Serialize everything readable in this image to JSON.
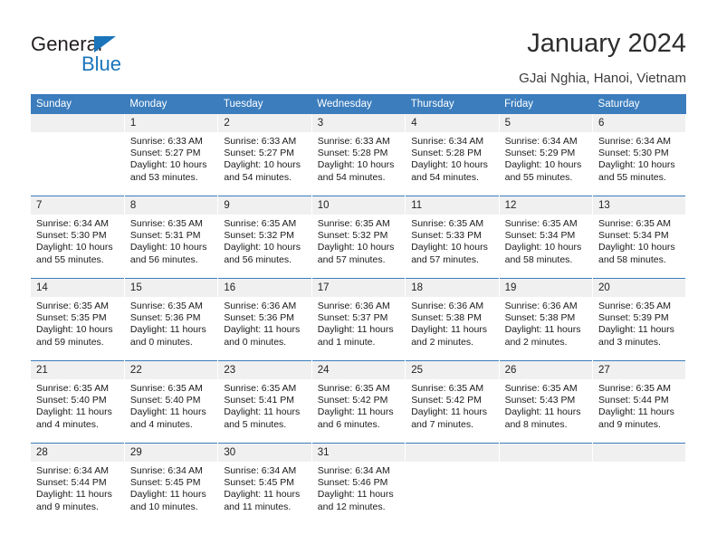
{
  "brand": {
    "name_top": "General",
    "name_bottom": "Blue",
    "triangle_color": "#1b75bb"
  },
  "header": {
    "title": "January 2024",
    "subtitle": "GJai Nghia, Hanoi, Vietnam",
    "header_bg": "#3b7dbd",
    "daynum_bg": "#f0f0f0"
  },
  "calendar": {
    "weekday_headers": [
      "Sunday",
      "Monday",
      "Tuesday",
      "Wednesday",
      "Thursday",
      "Friday",
      "Saturday"
    ],
    "labels": {
      "sunrise": "Sunrise:",
      "sunset": "Sunset:",
      "daylight": "Daylight:"
    },
    "weeks": [
      [
        {
          "day": "",
          "empty": true,
          "sunrise": "",
          "sunset": "",
          "daylight_1": "",
          "daylight_2": ""
        },
        {
          "day": "1",
          "empty": false,
          "sunrise": "Sunrise: 6:33 AM",
          "sunset": "Sunset: 5:27 PM",
          "daylight_1": "Daylight: 10 hours",
          "daylight_2": "and 53 minutes."
        },
        {
          "day": "2",
          "empty": false,
          "sunrise": "Sunrise: 6:33 AM",
          "sunset": "Sunset: 5:27 PM",
          "daylight_1": "Daylight: 10 hours",
          "daylight_2": "and 54 minutes."
        },
        {
          "day": "3",
          "empty": false,
          "sunrise": "Sunrise: 6:33 AM",
          "sunset": "Sunset: 5:28 PM",
          "daylight_1": "Daylight: 10 hours",
          "daylight_2": "and 54 minutes."
        },
        {
          "day": "4",
          "empty": false,
          "sunrise": "Sunrise: 6:34 AM",
          "sunset": "Sunset: 5:28 PM",
          "daylight_1": "Daylight: 10 hours",
          "daylight_2": "and 54 minutes."
        },
        {
          "day": "5",
          "empty": false,
          "sunrise": "Sunrise: 6:34 AM",
          "sunset": "Sunset: 5:29 PM",
          "daylight_1": "Daylight: 10 hours",
          "daylight_2": "and 55 minutes."
        },
        {
          "day": "6",
          "empty": false,
          "sunrise": "Sunrise: 6:34 AM",
          "sunset": "Sunset: 5:30 PM",
          "daylight_1": "Daylight: 10 hours",
          "daylight_2": "and 55 minutes."
        }
      ],
      [
        {
          "day": "7",
          "empty": false,
          "sunrise": "Sunrise: 6:34 AM",
          "sunset": "Sunset: 5:30 PM",
          "daylight_1": "Daylight: 10 hours",
          "daylight_2": "and 55 minutes."
        },
        {
          "day": "8",
          "empty": false,
          "sunrise": "Sunrise: 6:35 AM",
          "sunset": "Sunset: 5:31 PM",
          "daylight_1": "Daylight: 10 hours",
          "daylight_2": "and 56 minutes."
        },
        {
          "day": "9",
          "empty": false,
          "sunrise": "Sunrise: 6:35 AM",
          "sunset": "Sunset: 5:32 PM",
          "daylight_1": "Daylight: 10 hours",
          "daylight_2": "and 56 minutes."
        },
        {
          "day": "10",
          "empty": false,
          "sunrise": "Sunrise: 6:35 AM",
          "sunset": "Sunset: 5:32 PM",
          "daylight_1": "Daylight: 10 hours",
          "daylight_2": "and 57 minutes."
        },
        {
          "day": "11",
          "empty": false,
          "sunrise": "Sunrise: 6:35 AM",
          "sunset": "Sunset: 5:33 PM",
          "daylight_1": "Daylight: 10 hours",
          "daylight_2": "and 57 minutes."
        },
        {
          "day": "12",
          "empty": false,
          "sunrise": "Sunrise: 6:35 AM",
          "sunset": "Sunset: 5:34 PM",
          "daylight_1": "Daylight: 10 hours",
          "daylight_2": "and 58 minutes."
        },
        {
          "day": "13",
          "empty": false,
          "sunrise": "Sunrise: 6:35 AM",
          "sunset": "Sunset: 5:34 PM",
          "daylight_1": "Daylight: 10 hours",
          "daylight_2": "and 58 minutes."
        }
      ],
      [
        {
          "day": "14",
          "empty": false,
          "sunrise": "Sunrise: 6:35 AM",
          "sunset": "Sunset: 5:35 PM",
          "daylight_1": "Daylight: 10 hours",
          "daylight_2": "and 59 minutes."
        },
        {
          "day": "15",
          "empty": false,
          "sunrise": "Sunrise: 6:35 AM",
          "sunset": "Sunset: 5:36 PM",
          "daylight_1": "Daylight: 11 hours",
          "daylight_2": "and 0 minutes."
        },
        {
          "day": "16",
          "empty": false,
          "sunrise": "Sunrise: 6:36 AM",
          "sunset": "Sunset: 5:36 PM",
          "daylight_1": "Daylight: 11 hours",
          "daylight_2": "and 0 minutes."
        },
        {
          "day": "17",
          "empty": false,
          "sunrise": "Sunrise: 6:36 AM",
          "sunset": "Sunset: 5:37 PM",
          "daylight_1": "Daylight: 11 hours",
          "daylight_2": "and 1 minute."
        },
        {
          "day": "18",
          "empty": false,
          "sunrise": "Sunrise: 6:36 AM",
          "sunset": "Sunset: 5:38 PM",
          "daylight_1": "Daylight: 11 hours",
          "daylight_2": "and 2 minutes."
        },
        {
          "day": "19",
          "empty": false,
          "sunrise": "Sunrise: 6:36 AM",
          "sunset": "Sunset: 5:38 PM",
          "daylight_1": "Daylight: 11 hours",
          "daylight_2": "and 2 minutes."
        },
        {
          "day": "20",
          "empty": false,
          "sunrise": "Sunrise: 6:35 AM",
          "sunset": "Sunset: 5:39 PM",
          "daylight_1": "Daylight: 11 hours",
          "daylight_2": "and 3 minutes."
        }
      ],
      [
        {
          "day": "21",
          "empty": false,
          "sunrise": "Sunrise: 6:35 AM",
          "sunset": "Sunset: 5:40 PM",
          "daylight_1": "Daylight: 11 hours",
          "daylight_2": "and 4 minutes."
        },
        {
          "day": "22",
          "empty": false,
          "sunrise": "Sunrise: 6:35 AM",
          "sunset": "Sunset: 5:40 PM",
          "daylight_1": "Daylight: 11 hours",
          "daylight_2": "and 4 minutes."
        },
        {
          "day": "23",
          "empty": false,
          "sunrise": "Sunrise: 6:35 AM",
          "sunset": "Sunset: 5:41 PM",
          "daylight_1": "Daylight: 11 hours",
          "daylight_2": "and 5 minutes."
        },
        {
          "day": "24",
          "empty": false,
          "sunrise": "Sunrise: 6:35 AM",
          "sunset": "Sunset: 5:42 PM",
          "daylight_1": "Daylight: 11 hours",
          "daylight_2": "and 6 minutes."
        },
        {
          "day": "25",
          "empty": false,
          "sunrise": "Sunrise: 6:35 AM",
          "sunset": "Sunset: 5:42 PM",
          "daylight_1": "Daylight: 11 hours",
          "daylight_2": "and 7 minutes."
        },
        {
          "day": "26",
          "empty": false,
          "sunrise": "Sunrise: 6:35 AM",
          "sunset": "Sunset: 5:43 PM",
          "daylight_1": "Daylight: 11 hours",
          "daylight_2": "and 8 minutes."
        },
        {
          "day": "27",
          "empty": false,
          "sunrise": "Sunrise: 6:35 AM",
          "sunset": "Sunset: 5:44 PM",
          "daylight_1": "Daylight: 11 hours",
          "daylight_2": "and 9 minutes."
        }
      ],
      [
        {
          "day": "28",
          "empty": false,
          "sunrise": "Sunrise: 6:34 AM",
          "sunset": "Sunset: 5:44 PM",
          "daylight_1": "Daylight: 11 hours",
          "daylight_2": "and 9 minutes."
        },
        {
          "day": "29",
          "empty": false,
          "sunrise": "Sunrise: 6:34 AM",
          "sunset": "Sunset: 5:45 PM",
          "daylight_1": "Daylight: 11 hours",
          "daylight_2": "and 10 minutes."
        },
        {
          "day": "30",
          "empty": false,
          "sunrise": "Sunrise: 6:34 AM",
          "sunset": "Sunset: 5:45 PM",
          "daylight_1": "Daylight: 11 hours",
          "daylight_2": "and 11 minutes."
        },
        {
          "day": "31",
          "empty": false,
          "sunrise": "Sunrise: 6:34 AM",
          "sunset": "Sunset: 5:46 PM",
          "daylight_1": "Daylight: 11 hours",
          "daylight_2": "and 12 minutes."
        },
        {
          "day": "",
          "empty": true,
          "sunrise": "",
          "sunset": "",
          "daylight_1": "",
          "daylight_2": ""
        },
        {
          "day": "",
          "empty": true,
          "sunrise": "",
          "sunset": "",
          "daylight_1": "",
          "daylight_2": ""
        },
        {
          "day": "",
          "empty": true,
          "sunrise": "",
          "sunset": "",
          "daylight_1": "",
          "daylight_2": ""
        }
      ]
    ]
  }
}
